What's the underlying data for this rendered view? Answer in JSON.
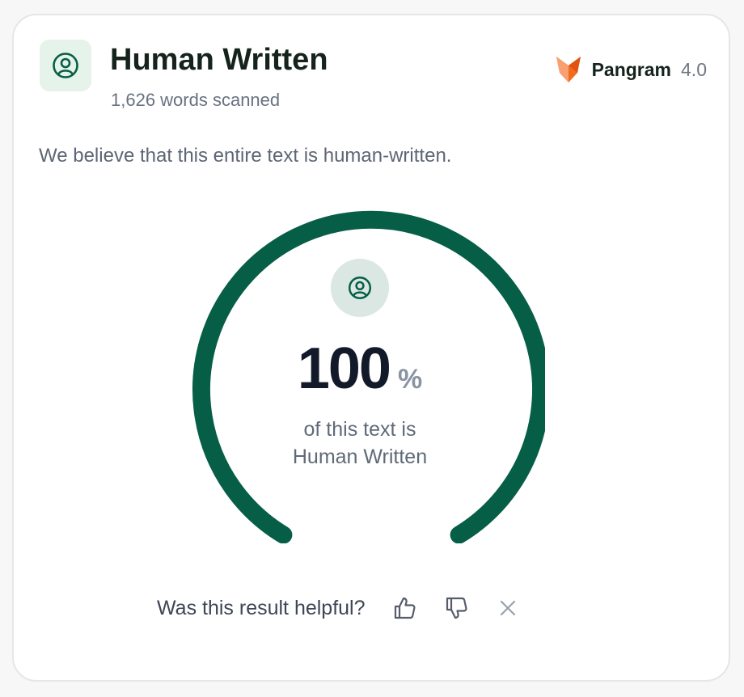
{
  "result": {
    "title": "Human Written",
    "words_scanned": "1,626 words scanned",
    "summary": "We believe that this entire text is human-written.",
    "icon": "person-circle-icon"
  },
  "brand": {
    "name": "Pangram",
    "version": "4.0",
    "logo_icon": "fox-logo-icon",
    "logo_color": "#f26b1d"
  },
  "gauge": {
    "percent": 100,
    "percent_label": "100",
    "percent_sign": "%",
    "caption_line1": "of this text is",
    "caption_line2": "Human Written",
    "color": "#075e46"
  },
  "feedback": {
    "question": "Was this result helpful?",
    "thumbs_up_icon": "thumbs-up-icon",
    "thumbs_down_icon": "thumbs-down-icon",
    "dismiss_icon": "close-icon"
  },
  "colors": {
    "accent": "#075e46",
    "accent_light": "#e5f3ea"
  }
}
